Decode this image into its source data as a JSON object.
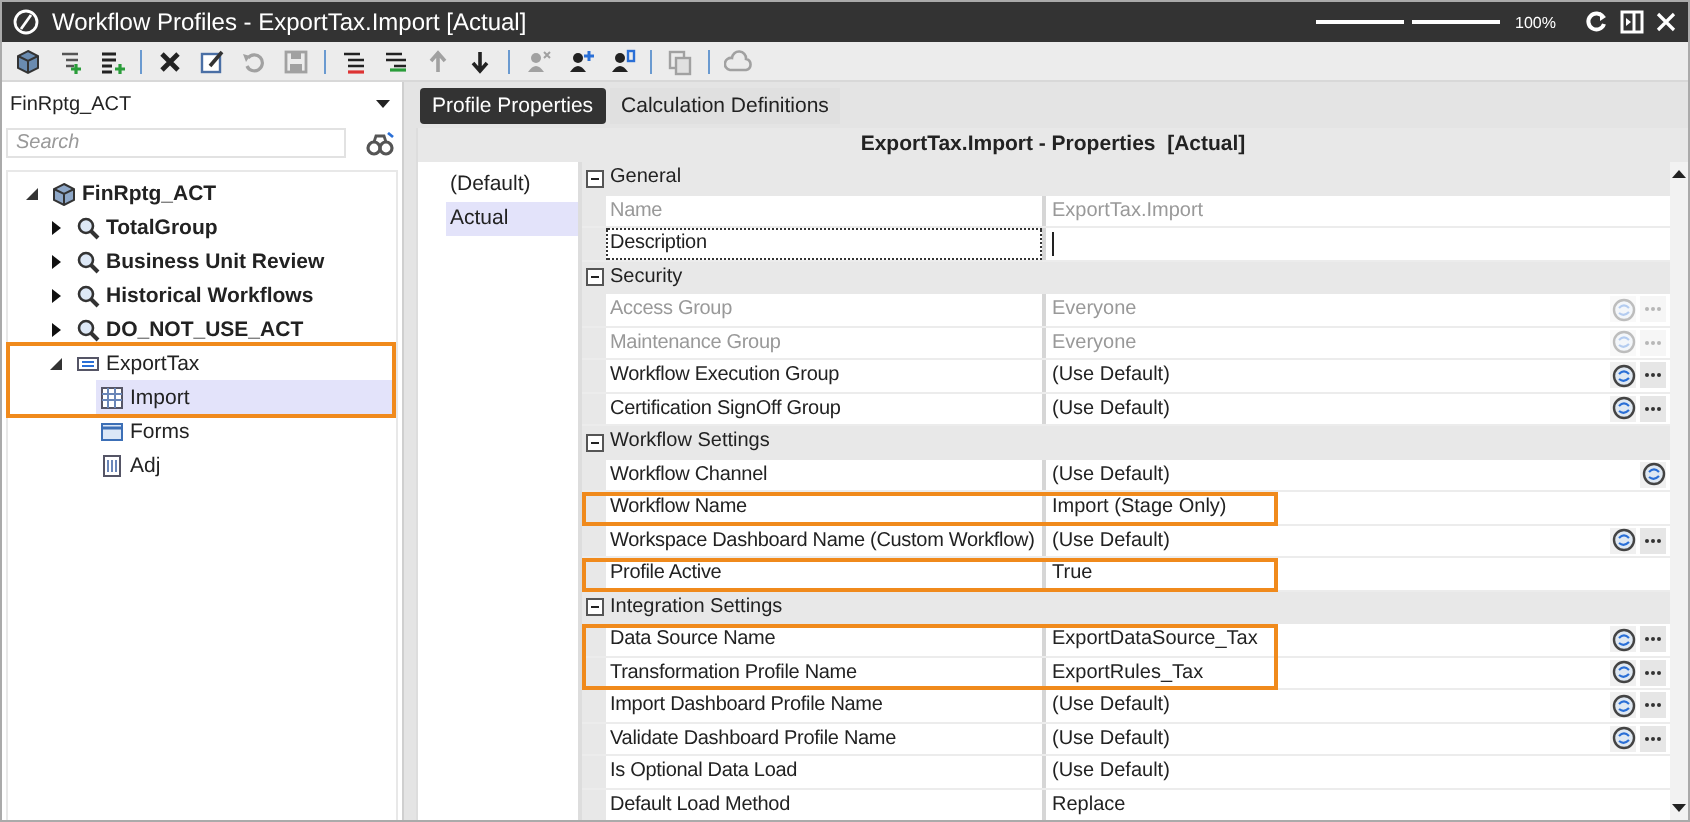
{
  "window": {
    "title": "Workflow Profiles - ExportTax.Import [Actual]",
    "zoom": {
      "level": 0.5,
      "reading": "100%"
    }
  },
  "toolbar": [
    {
      "kind": "cube",
      "disabled": false
    },
    {
      "kind": "indent-add",
      "disabled": false
    },
    {
      "kind": "list-add",
      "disabled": false
    },
    {
      "kind": "sep"
    },
    {
      "kind": "delete",
      "disabled": false
    },
    {
      "kind": "edit",
      "disabled": false
    },
    {
      "kind": "undo",
      "disabled": true
    },
    {
      "kind": "save",
      "disabled": true
    },
    {
      "kind": "sep"
    },
    {
      "kind": "outdent",
      "disabled": false
    },
    {
      "kind": "indent",
      "disabled": false
    },
    {
      "kind": "up",
      "disabled": true
    },
    {
      "kind": "down",
      "disabled": false
    },
    {
      "kind": "sep"
    },
    {
      "kind": "user-x",
      "disabled": true
    },
    {
      "kind": "user-plus",
      "disabled": false
    },
    {
      "kind": "user-num",
      "disabled": false
    },
    {
      "kind": "sep"
    },
    {
      "kind": "copy",
      "disabled": true
    },
    {
      "kind": "sep"
    },
    {
      "kind": "cloud",
      "disabled": true
    }
  ],
  "sidebar": {
    "dropdown": {
      "value": "FinRptg_ACT"
    },
    "search": {
      "placeholder": "Search"
    },
    "tree": [
      {
        "label": "FinRptg_ACT",
        "kind": "cube",
        "expanded": true,
        "selected": false,
        "highlighted": false,
        "children": [
          {
            "label": "TotalGroup",
            "kind": "group",
            "expanded": false,
            "selected": false,
            "highlighted": false
          },
          {
            "label": "Business Unit Review",
            "kind": "group",
            "expanded": false,
            "selected": false,
            "highlighted": false
          },
          {
            "label": "Historical Workflows",
            "kind": "group",
            "expanded": false,
            "selected": false,
            "highlighted": false
          },
          {
            "label": "DO_NOT_USE_ACT",
            "kind": "group",
            "expanded": false,
            "selected": false,
            "highlighted": false
          },
          {
            "label": "ExportTax",
            "kind": "profile",
            "expanded": true,
            "selected": false,
            "highlighted": true,
            "children": [
              {
                "label": "Import",
                "kind": "import",
                "selected": true,
                "highlighted": true
              },
              {
                "label": "Forms",
                "kind": "forms",
                "selected": false,
                "highlighted": false
              },
              {
                "label": "Adj",
                "kind": "adj",
                "selected": false,
                "highlighted": false
              }
            ]
          }
        ]
      }
    ]
  },
  "tabs": [
    {
      "label": "Profile Properties",
      "selected": true
    },
    {
      "label": "Calculation Definitions",
      "selected": false
    }
  ],
  "properties": {
    "header": "ExportTax.Import - Properties  [Actual]",
    "scenarios": [
      {
        "label": "(Default)",
        "selected": false
      },
      {
        "label": "Actual",
        "selected": true
      }
    ],
    "rows": [
      {
        "kind": "category",
        "label": "General",
        "expanded": true
      },
      {
        "kind": "property",
        "label": "Name",
        "value": "ExportTax.Import",
        "disabled": true,
        "focused": false,
        "highlighted": false,
        "globe_button": false,
        "more_button": false
      },
      {
        "kind": "property",
        "label": "Description",
        "disabled": false,
        "focused": true,
        "highlighted": false,
        "globe_button": false,
        "more_button": false
      },
      {
        "kind": "category",
        "label": "Security",
        "expanded": true
      },
      {
        "kind": "property",
        "label": "Access Group",
        "value": "Everyone",
        "disabled": true,
        "focused": false,
        "highlighted": false,
        "globe_button": true,
        "more_button": true
      },
      {
        "kind": "property",
        "label": "Maintenance Group",
        "value": "Everyone",
        "disabled": true,
        "focused": false,
        "highlighted": false,
        "globe_button": true,
        "more_button": true
      },
      {
        "kind": "property",
        "label": "Workflow Execution Group",
        "value": "(Use Default)",
        "disabled": false,
        "focused": false,
        "highlighted": false,
        "globe_button": true,
        "more_button": true
      },
      {
        "kind": "property",
        "label": "Certification SignOff Group",
        "value": "(Use Default)",
        "disabled": false,
        "focused": false,
        "highlighted": false,
        "globe_button": true,
        "more_button": true
      },
      {
        "kind": "category",
        "label": "Workflow Settings",
        "expanded": true
      },
      {
        "kind": "property",
        "label": "Workflow Channel",
        "value": "(Use Default)",
        "disabled": false,
        "focused": false,
        "highlighted": false,
        "globe_button": true,
        "more_button": false
      },
      {
        "kind": "property",
        "label": "Workflow Name",
        "value": "Import  (Stage Only)",
        "disabled": false,
        "focused": false,
        "highlighted": true,
        "globe_button": false,
        "more_button": false
      },
      {
        "kind": "property",
        "label": "Workspace Dashboard Name (Custom Workflow)",
        "value": "(Use Default)",
        "disabled": false,
        "focused": false,
        "highlighted": false,
        "globe_button": true,
        "more_button": true
      },
      {
        "kind": "property",
        "label": "Profile Active",
        "value": "True",
        "disabled": false,
        "focused": false,
        "highlighted": true,
        "globe_button": false,
        "more_button": false
      },
      {
        "kind": "category",
        "label": "Integration Settings",
        "expanded": true
      },
      {
        "kind": "property",
        "label": "Data Source Name",
        "value": "ExportDataSource_Tax",
        "disabled": false,
        "focused": false,
        "highlighted": true,
        "globe_button": true,
        "more_button": true
      },
      {
        "kind": "property",
        "label": "Transformation Profile Name",
        "value": "ExportRules_Tax",
        "disabled": false,
        "focused": false,
        "highlighted": true,
        "globe_button": true,
        "more_button": true
      },
      {
        "kind": "property",
        "label": "Import Dashboard Profile Name",
        "value": "(Use Default)",
        "disabled": false,
        "focused": false,
        "highlighted": false,
        "globe_button": true,
        "more_button": true
      },
      {
        "kind": "property",
        "label": "Validate Dashboard Profile Name",
        "value": "(Use Default)",
        "disabled": false,
        "focused": false,
        "highlighted": false,
        "globe_button": true,
        "more_button": true
      },
      {
        "kind": "property",
        "label": "Is Optional Data Load",
        "value": "(Use Default)",
        "disabled": false,
        "focused": false,
        "highlighted": false,
        "globe_button": false,
        "more_button": false
      },
      {
        "kind": "property",
        "label": "Default Load Method",
        "value": "Replace",
        "disabled": false,
        "focused": false,
        "highlighted": false,
        "globe_button": false,
        "more_button": false
      }
    ]
  }
}
